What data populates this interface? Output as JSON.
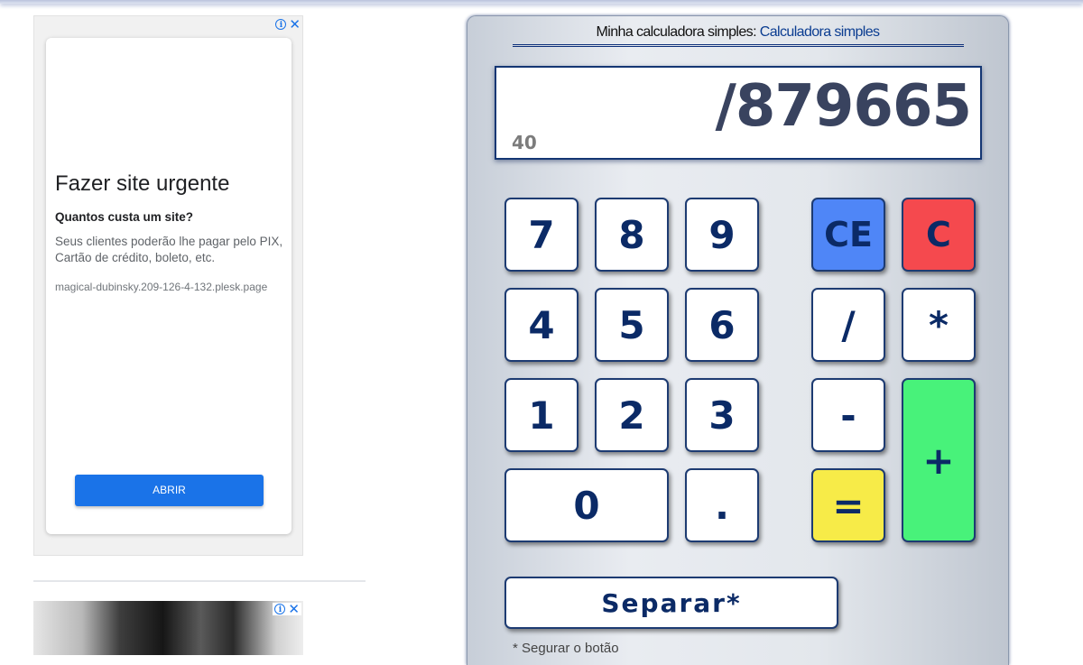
{
  "ads": {
    "top": {
      "title": "Fazer site urgente",
      "subtitle": "Quantos custa um site?",
      "description": "Seus clientes poderão lhe pagar pelo PIX, Cartão de crédito, boleto, etc.",
      "url": "magical-dubinsky.209-126-4-132.plesk.page",
      "button": "ABRIR",
      "info_icon": "i",
      "close_icon": "✕"
    },
    "bottom": {
      "info_icon": "i",
      "close_icon": "✕"
    }
  },
  "calculator": {
    "header_label": "Minha calculadora simples: ",
    "header_link": "Calculadora simples",
    "display_main": "/879665",
    "display_secondary": "40",
    "keys": {
      "k7": "7",
      "k8": "8",
      "k9": "9",
      "k4": "4",
      "k5": "5",
      "k6": "6",
      "k1": "1",
      "k2": "2",
      "k3": "3",
      "k0": "0",
      "dot": ".",
      "ce": "CE",
      "c": "C",
      "div": "/",
      "mul": "*",
      "minus": "-",
      "plus": "+",
      "eq": "=",
      "separate": "Separar*"
    },
    "footnote": "* Segurar o botão",
    "colors": {
      "ce": "#4f86f7",
      "c": "#f5494e",
      "eq": "#f7eb48",
      "plus": "#48f27a",
      "key_text": "#0b2a66"
    }
  }
}
